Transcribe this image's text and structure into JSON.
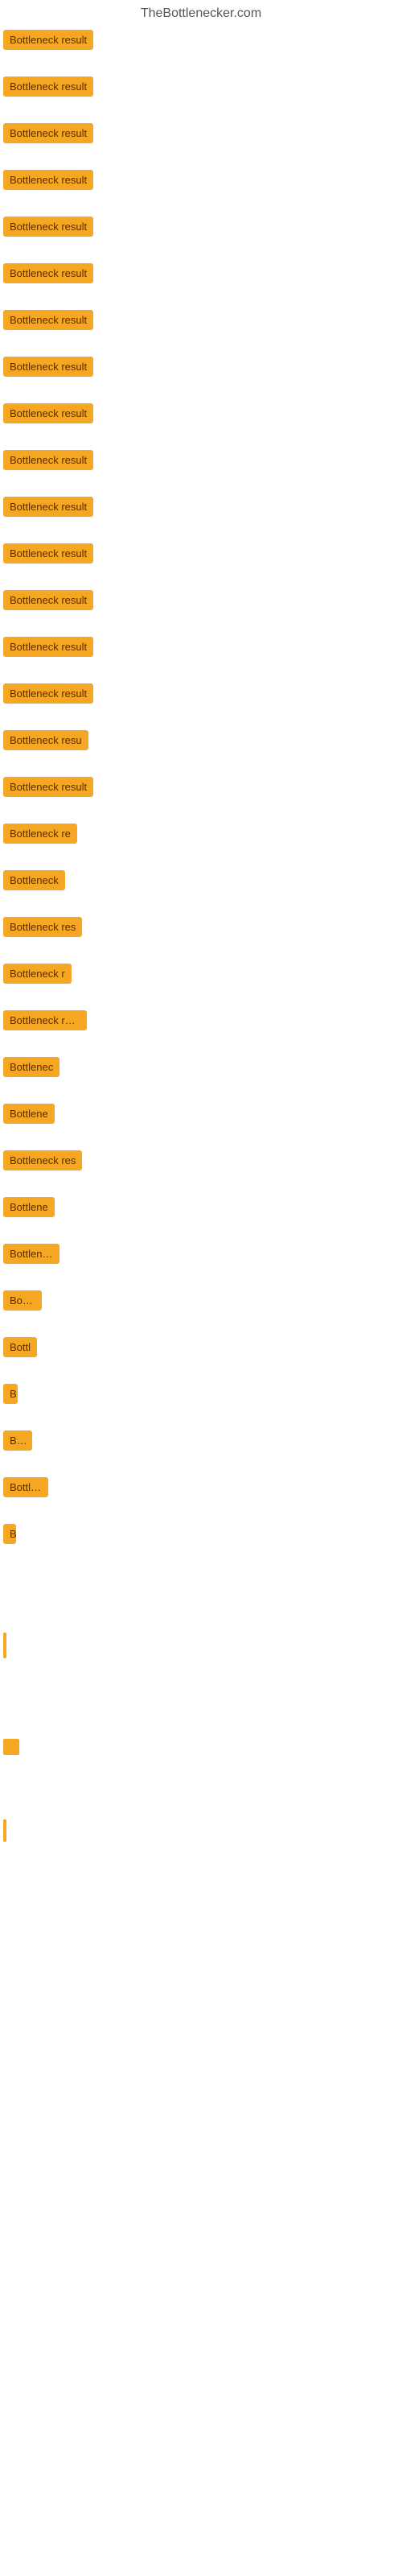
{
  "site": {
    "title": "TheBottlenecker.com"
  },
  "items": [
    {
      "id": 1,
      "label": "Bottleneck result",
      "truncated": false
    },
    {
      "id": 2,
      "label": "Bottleneck result",
      "truncated": false
    },
    {
      "id": 3,
      "label": "Bottleneck result",
      "truncated": false
    },
    {
      "id": 4,
      "label": "Bottleneck result",
      "truncated": false
    },
    {
      "id": 5,
      "label": "Bottleneck result",
      "truncated": false
    },
    {
      "id": 6,
      "label": "Bottleneck result",
      "truncated": false
    },
    {
      "id": 7,
      "label": "Bottleneck result",
      "truncated": false
    },
    {
      "id": 8,
      "label": "Bottleneck result",
      "truncated": false
    },
    {
      "id": 9,
      "label": "Bottleneck result",
      "truncated": false
    },
    {
      "id": 10,
      "label": "Bottleneck result",
      "truncated": false
    },
    {
      "id": 11,
      "label": "Bottleneck result",
      "truncated": false
    },
    {
      "id": 12,
      "label": "Bottleneck result",
      "truncated": false
    },
    {
      "id": 13,
      "label": "Bottleneck result",
      "truncated": false
    },
    {
      "id": 14,
      "label": "Bottleneck result",
      "truncated": false
    },
    {
      "id": 15,
      "label": "Bottleneck result",
      "truncated": false
    },
    {
      "id": 16,
      "label": "Bottleneck resu",
      "truncated": true
    },
    {
      "id": 17,
      "label": "Bottleneck result",
      "truncated": false
    },
    {
      "id": 18,
      "label": "Bottleneck re",
      "truncated": true
    },
    {
      "id": 19,
      "label": "Bottleneck",
      "truncated": true
    },
    {
      "id": 20,
      "label": "Bottleneck res",
      "truncated": true
    },
    {
      "id": 21,
      "label": "Bottleneck r",
      "truncated": true
    },
    {
      "id": 22,
      "label": "Bottleneck resu",
      "truncated": true
    },
    {
      "id": 23,
      "label": "Bottlenec",
      "truncated": true
    },
    {
      "id": 24,
      "label": "Bottlene",
      "truncated": true
    },
    {
      "id": 25,
      "label": "Bottleneck res",
      "truncated": true
    },
    {
      "id": 26,
      "label": "Bottlene",
      "truncated": true
    },
    {
      "id": 27,
      "label": "Bottlenec",
      "truncated": true
    },
    {
      "id": 28,
      "label": "Bottle",
      "truncated": true
    },
    {
      "id": 29,
      "label": "Bottl",
      "truncated": true
    },
    {
      "id": 30,
      "label": "B",
      "truncated": true
    },
    {
      "id": 31,
      "label": "Bott",
      "truncated": true
    },
    {
      "id": 32,
      "label": "Bottlen",
      "truncated": true
    },
    {
      "id": 33,
      "label": "B",
      "truncated": true
    }
  ]
}
